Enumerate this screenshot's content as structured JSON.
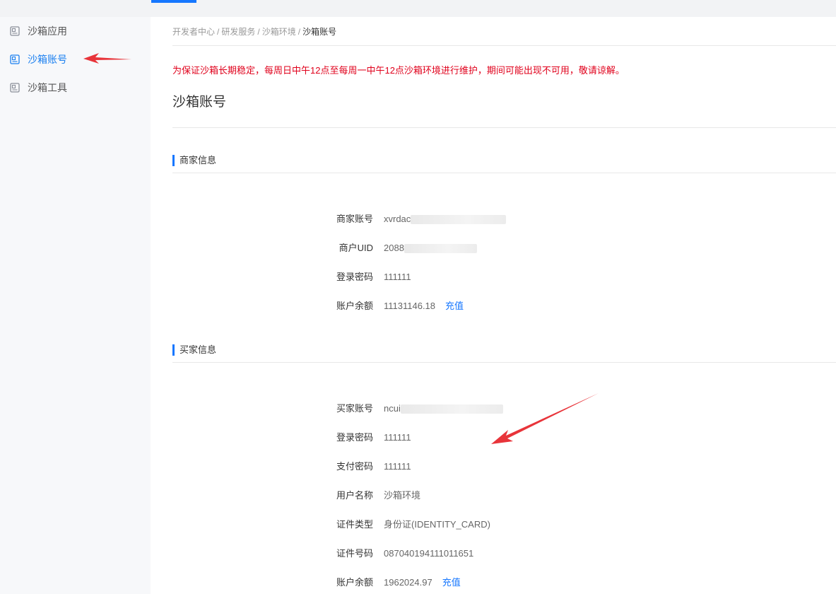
{
  "sidebar": {
    "items": [
      {
        "label": "沙箱应用",
        "icon": "app-card-icon"
      },
      {
        "label": "沙箱账号",
        "icon": "app-card-icon"
      },
      {
        "label": "沙箱工具",
        "icon": "app-card-icon"
      }
    ],
    "active_index": 1
  },
  "breadcrumb": [
    "开发者中心",
    "研发服务",
    "沙箱环境",
    "沙箱账号"
  ],
  "notice": "为保证沙箱长期稳定，每周日中午12点至每周一中午12点沙箱环境进行维护，期间可能出现不可用，敬请谅解。",
  "page_title": "沙箱账号",
  "merchant": {
    "section_title": "商家信息",
    "account_label": "商家账号",
    "account_value": "xvrdac",
    "uid_label": "商户UID",
    "uid_value": "2088",
    "password_label": "登录密码",
    "password_value": "111111",
    "balance_label": "账户余额",
    "balance_value": "11131146.18",
    "recharge_label": "充值"
  },
  "buyer": {
    "section_title": "买家信息",
    "account_label": "买家账号",
    "account_value": "ncui",
    "login_password_label": "登录密码",
    "login_password_value": "111111",
    "pay_password_label": "支付密码",
    "pay_password_value": "111111",
    "username_label": "用户名称",
    "username_value": "沙箱环境",
    "id_type_label": "证件类型",
    "id_type_value": "身份证(IDENTITY_CARD)",
    "id_number_label": "证件号码",
    "id_number_value": "087040194111011651",
    "balance_label": "账户余额",
    "balance_value": "1962024.97",
    "recharge_label": "充值"
  },
  "colors": {
    "accent": "#1677ff",
    "notice": "#e0001b",
    "annotation_arrow": "#e8343a"
  }
}
